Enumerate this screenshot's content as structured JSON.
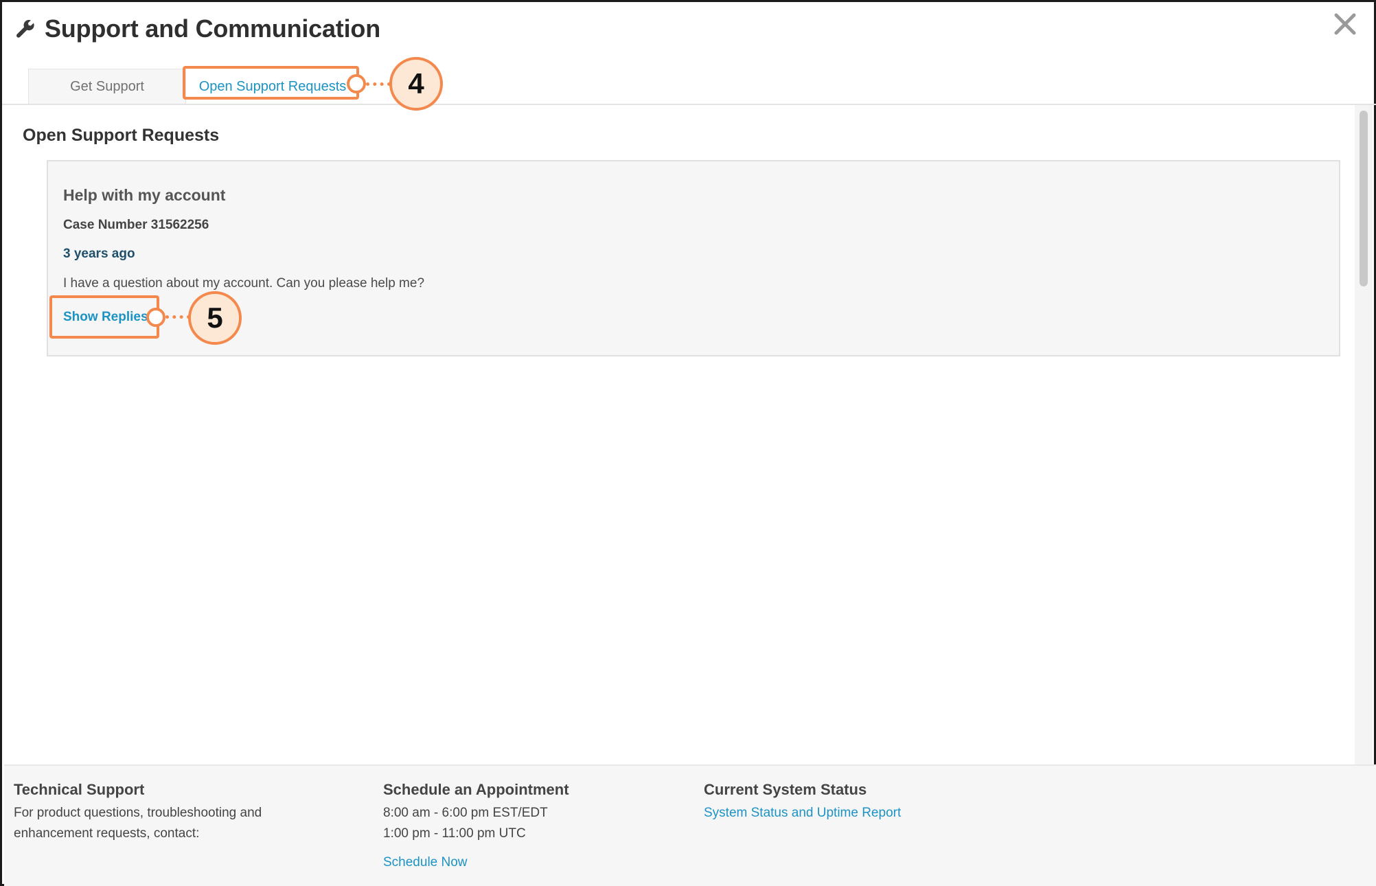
{
  "window": {
    "title": "Support and Communication",
    "icons": {
      "title": "wrench-icon",
      "close": "close-icon"
    }
  },
  "tabs": [
    {
      "label": "Get Support",
      "active": false
    },
    {
      "label": "Open Support Requests",
      "active": true
    }
  ],
  "callouts": {
    "tab_marker": "4",
    "replies_marker": "5"
  },
  "main": {
    "section_title": "Open Support Requests",
    "requests": [
      {
        "title": "Help with my account",
        "case_number": "Case Number 31562256",
        "age": "3 years ago",
        "message": "I have a question about my account. Can you please help me?",
        "show_replies_label": "Show Replies"
      }
    ]
  },
  "footer": {
    "technical": {
      "heading": "Technical Support",
      "line1": "For product questions, troubleshooting and",
      "line2": "enhancement requests, contact:"
    },
    "appointment": {
      "heading": "Schedule an Appointment",
      "hours_local": "8:00 am - 6:00 pm EST/EDT",
      "hours_utc": "1:00 pm - 11:00 pm UTC",
      "link": "Schedule Now"
    },
    "status": {
      "heading": "Current System Status",
      "link": "System Status and Uptime Report"
    }
  },
  "colors": {
    "accent": "#1c93c4",
    "highlight": "#f4894e",
    "callout_fill": "#fde8d6",
    "case_date": "#1f4f6b"
  }
}
